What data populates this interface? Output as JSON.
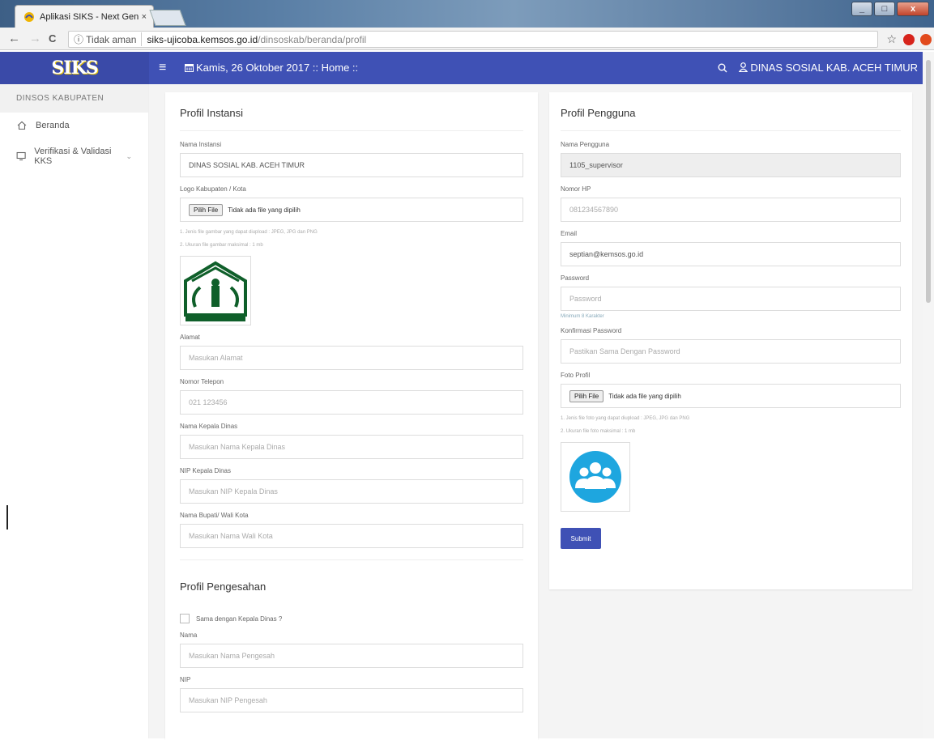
{
  "browser": {
    "tab_title": "Aplikasi SIKS - Next Gen",
    "tab_close": "×",
    "security_label": "Tidak aman",
    "url_host": "siks-ujicoba.kemsos.go.id",
    "url_path": "/dinsoskab/beranda/profil",
    "back": "←",
    "forward": "→",
    "reload": "C",
    "info": "ⓘ",
    "star": "☆",
    "min": "_",
    "max": "□",
    "close": "x"
  },
  "app": {
    "logo": "SIKS",
    "menu_icon": "≡",
    "date_crumb": "Kamis, 26 Oktober 2017 :: Home ::",
    "search_icon": "🔍",
    "user_label": "DINAS SOSIAL KAB. ACEH TIMUR"
  },
  "sidebar": {
    "section": "DINSOS KABUPATEN",
    "items": [
      {
        "label": "Beranda",
        "icon": "home-icon"
      },
      {
        "label": "Verifikasi & Validasi KKS",
        "icon": "monitor-icon"
      }
    ]
  },
  "profil_instansi": {
    "title": "Profil Instansi",
    "nama_label": "Nama Instansi",
    "nama_value": "DINAS SOSIAL KAB. ACEH TIMUR",
    "logo_label": "Logo Kabupaten / Kota",
    "file_button": "Pilih File",
    "file_text": "Tidak ada file yang dipilih",
    "hint1": "1. Jenis file gambar yang dapat diupload : JPEG, JPG dan PNG",
    "hint2": "2. Ukuran file gambar maksimal : 1 mb",
    "alamat_label": "Alamat",
    "alamat_placeholder": "Masukan Alamat",
    "telepon_label": "Nomor Telepon",
    "telepon_value": "021 123456",
    "kepala_label": "Nama Kepala Dinas",
    "kepala_placeholder": "Masukan Nama Kepala Dinas",
    "nip_kepala_label": "NIP Kepala Dinas",
    "nip_kepala_placeholder": "Masukan NIP Kepala Dinas",
    "bupati_label": "Nama Bupati/ Wali Kota",
    "bupati_placeholder": "Masukan Nama Wali Kota"
  },
  "profil_pengesahan": {
    "title": "Profil Pengesahan",
    "checkbox_label": "Sama dengan Kepala Dinas ?",
    "nama_label": "Nama",
    "nama_placeholder": "Masukan Nama Pengesah",
    "nip_label": "NIP",
    "nip_placeholder": "Masukan NIP Pengesah"
  },
  "profil_pengguna": {
    "title": "Profil Pengguna",
    "nama_label": "Nama Pengguna",
    "nama_value": "1105_supervisor",
    "hp_label": "Nomor HP",
    "hp_value": "081234567890",
    "email_label": "Email",
    "email_value": "septian@kemsos.go.id",
    "password_label": "Password",
    "password_placeholder": "Password",
    "password_hint": "Minimum 8 Karakter",
    "konfirmasi_label": "Konfirmasi Password",
    "konfirmasi_placeholder": "Pastikan Sama Dengan Password",
    "foto_label": "Foto Profil",
    "file_button": "Pilih File",
    "file_text": "Tidak ada file yang dipilih",
    "hint1": "1. Jenis file foto yang dapat diupload : JPEG, JPG dan PNG",
    "hint2": "2. Ukuran file foto maksimal : 1 mb",
    "submit": "Submit"
  }
}
